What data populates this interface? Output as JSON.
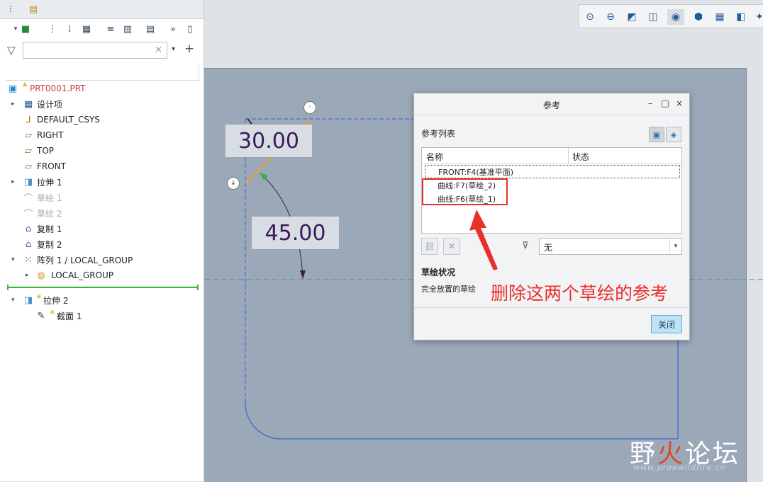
{
  "model_tree": {
    "items": [
      {
        "label": "PRT0001.PRT",
        "icon": "part-icon"
      },
      {
        "label": "设计项",
        "icon": "design-items-icon"
      },
      {
        "label": "DEFAULT_CSYS",
        "icon": "csys-icon"
      },
      {
        "label": "RIGHT",
        "icon": "datum-plane-icon"
      },
      {
        "label": "TOP",
        "icon": "datum-plane-icon"
      },
      {
        "label": "FRONT",
        "icon": "datum-plane-icon"
      },
      {
        "label": "拉伸 1",
        "icon": "extrude-icon"
      },
      {
        "label": "草绘 1",
        "icon": "sketch-icon"
      },
      {
        "label": "草绘 2",
        "icon": "sketch-icon"
      },
      {
        "label": "复制 1",
        "icon": "copy-icon"
      },
      {
        "label": "复制 2",
        "icon": "copy-icon"
      },
      {
        "label": "阵列 1 / LOCAL_GROUP",
        "icon": "pattern-icon"
      },
      {
        "label": "LOCAL_GROUP",
        "icon": "group-icon"
      },
      {
        "label": "拉伸 2",
        "icon": "extrude-icon"
      },
      {
        "label": "截面 1",
        "icon": "section-icon"
      }
    ],
    "search": {
      "value": ""
    }
  },
  "dimensions": {
    "upper": "30.00",
    "lower": "45.00"
  },
  "dialog": {
    "title": "参考",
    "ref_list_label": "参考列表",
    "columns": [
      "名称",
      "状态"
    ],
    "rows": [
      "FRONT:F4(基准平面)",
      "曲线:F7(草绘_2)",
      "曲线:F6(草绘_1)"
    ],
    "filter_value": "无",
    "sketch_status_title": "草绘状况",
    "sketch_status_text": "完全放置的草绘",
    "close_label": "关闭"
  },
  "annotation": "删除这两个草绘的参考",
  "watermark": {
    "text_a": "野",
    "text_b": "火",
    "text_c": "论坛",
    "url": "www.proewildfire.cn"
  },
  "colors": {
    "highlight": "#e8302b",
    "sketch_line": "#3a62d8",
    "dim_line": "#f0a030"
  }
}
